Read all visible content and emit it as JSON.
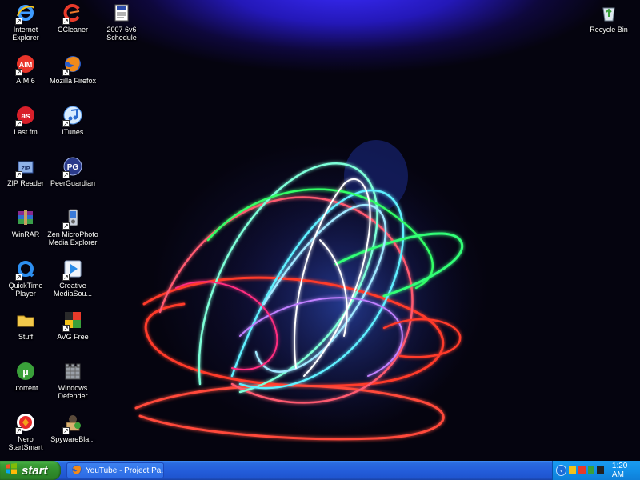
{
  "desktop": {
    "icons": [
      {
        "label_1": "Internet",
        "label_2": "Explorer",
        "icon": "internet-explorer-icon"
      },
      {
        "label_1": "CCleaner",
        "label_2": "",
        "icon": "ccleaner-icon"
      },
      {
        "label_1": "2007 6v6",
        "label_2": "Schedule",
        "icon": "document-icon"
      },
      {
        "label_1": "AIM 6",
        "label_2": "",
        "icon": "aim-icon"
      },
      {
        "label_1": "Mozilla Firefox",
        "label_2": "",
        "icon": "firefox-icon"
      },
      {
        "label_1": "Last.fm",
        "label_2": "",
        "icon": "lastfm-icon"
      },
      {
        "label_1": "iTunes",
        "label_2": "",
        "icon": "itunes-icon"
      },
      {
        "label_1": "ZIP Reader",
        "label_2": "",
        "icon": "zip-reader-icon"
      },
      {
        "label_1": "PeerGuardian",
        "label_2": "",
        "icon": "peerguardian-icon"
      },
      {
        "label_1": "WinRAR",
        "label_2": "",
        "icon": "winrar-icon"
      },
      {
        "label_1": "Zen MicroPhoto",
        "label_2": "Media Explorer",
        "icon": "zen-media-explorer-icon"
      },
      {
        "label_1": "QuickTime",
        "label_2": "Player",
        "icon": "quicktime-icon"
      },
      {
        "label_1": "Creative",
        "label_2": "MediaSou...",
        "icon": "creative-mediasource-icon"
      },
      {
        "label_1": "Stuff",
        "label_2": "",
        "icon": "folder-icon"
      },
      {
        "label_1": "AVG Free",
        "label_2": "",
        "icon": "avg-icon"
      },
      {
        "label_1": "utorrent",
        "label_2": "",
        "icon": "utorrent-icon"
      },
      {
        "label_1": "Windows",
        "label_2": "Defender",
        "icon": "windows-defender-icon"
      },
      {
        "label_1": "Nero",
        "label_2": "StartSmart",
        "icon": "nero-icon"
      },
      {
        "label_1": "SpywareBla...",
        "label_2": "",
        "icon": "spywareblaster-icon"
      },
      {
        "label_1": "Recycle Bin",
        "label_2": "",
        "icon": "recycle-bin-icon"
      }
    ]
  },
  "taskbar": {
    "start_label": "start",
    "task_youtube": "YouTube - Project Pa...",
    "clock": "1:20 AM"
  },
  "colors": {
    "taskbar_blue": "#245edb",
    "start_green": "#3a9d36",
    "tray_blue": "#1290e8"
  }
}
